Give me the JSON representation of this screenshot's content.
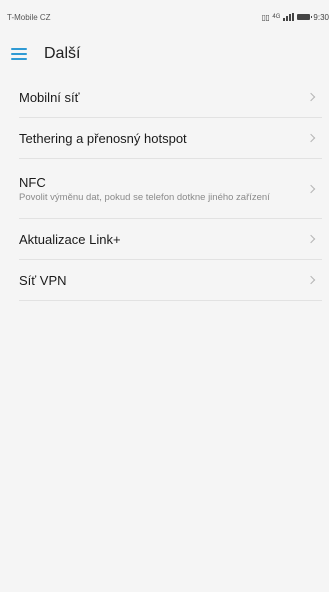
{
  "status_bar": {
    "carrier": "T-Mobile CZ",
    "sim_label": "ß",
    "network": "4G",
    "time": "9:30"
  },
  "header": {
    "title": "Další",
    "menu_icon": "hamburger-menu-icon",
    "accent_color": "#2f9ad4"
  },
  "items": [
    {
      "title": "Mobilní síť",
      "subtitle": ""
    },
    {
      "title": "Tethering a přenosný hotspot",
      "subtitle": ""
    },
    {
      "title": "NFC",
      "subtitle": "Povolit výměnu dat, pokud se telefon dotkne jiného zařízení"
    },
    {
      "title": "Aktualizace Link+",
      "subtitle": ""
    },
    {
      "title": "Síť VPN",
      "subtitle": ""
    }
  ]
}
